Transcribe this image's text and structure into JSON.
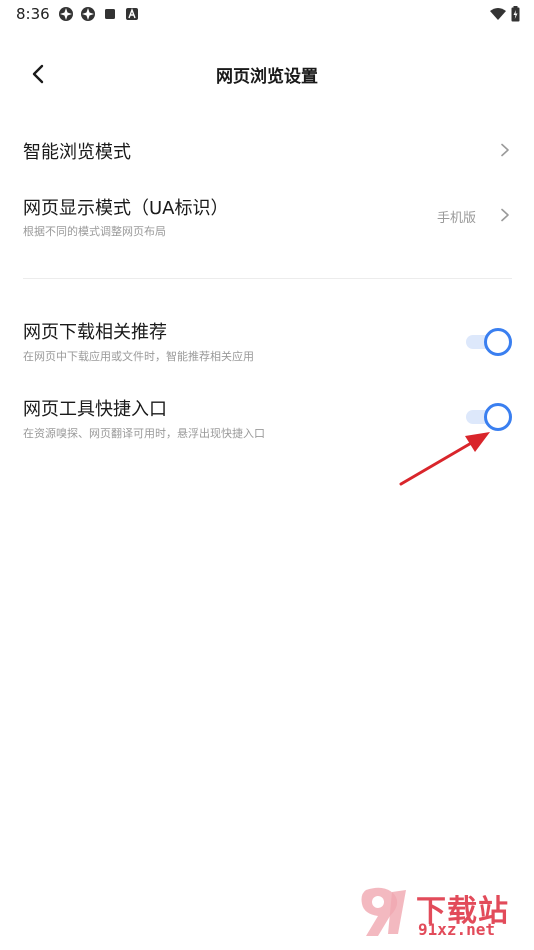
{
  "status_bar": {
    "time": "8:36"
  },
  "header": {
    "title": "网页浏览设置"
  },
  "settings": {
    "smart_browse": {
      "title": "智能浏览模式"
    },
    "display_mode": {
      "title": "网页显示模式（UA标识）",
      "subtitle": "根据不同的模式调整网页布局",
      "value": "手机版"
    },
    "download_recommend": {
      "title": "网页下载相关推荐",
      "subtitle": "在网页中下载应用或文件时，智能推荐相关应用",
      "enabled": true
    },
    "tool_shortcut": {
      "title": "网页工具快捷入口",
      "subtitle": "在资源嗅探、网页翻译可用时，悬浮出现快捷入口",
      "enabled": true
    }
  },
  "watermark": {
    "brand": "下载站",
    "site": "91xz.net"
  },
  "colors": {
    "accent": "#3a7ff0",
    "track": "#dde8fb",
    "annotation": "#d9252b",
    "watermark": "#e24b5a"
  }
}
